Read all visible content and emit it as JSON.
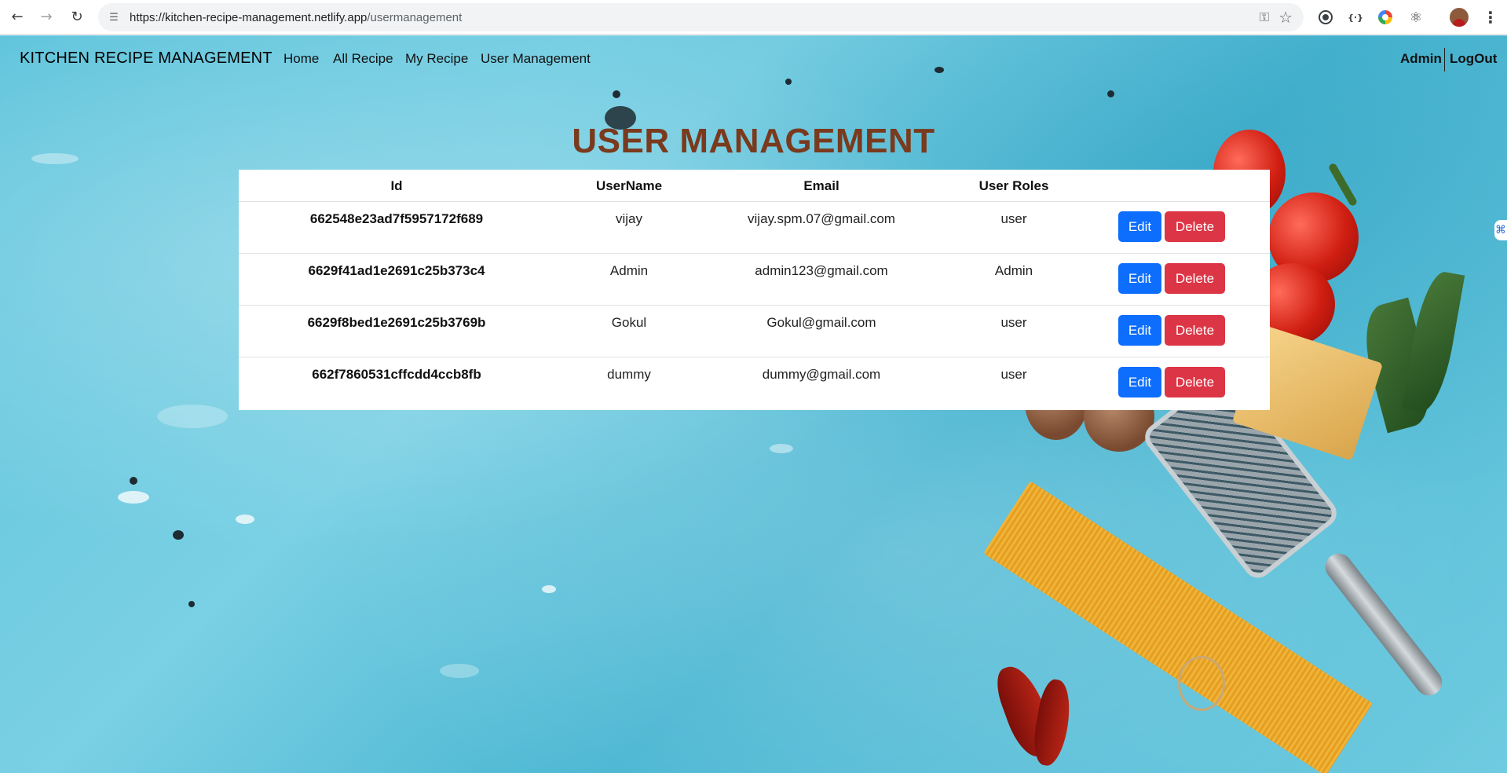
{
  "browser": {
    "url_host": "https://kitchen-recipe-management.netlify.app",
    "url_path": "/usermanagement",
    "icons": [
      "back-icon",
      "forward-icon",
      "reload-icon",
      "site-settings-icon",
      "password-key-icon",
      "bookmark-star-icon",
      "record-extension-icon",
      "code-extension-icon",
      "color-extension-icon",
      "extensions-puzzle-icon",
      "profile-avatar-icon",
      "kebab-menu-icon"
    ]
  },
  "navbar": {
    "brand": "KITCHEN RECIPE MANAGEMENT",
    "links": [
      "Home",
      "All Recipe",
      "My Recipe",
      "User Management"
    ],
    "user": "Admin",
    "logout": "LogOut"
  },
  "page": {
    "heading": "USER MANAGEMENT"
  },
  "table": {
    "headers": [
      "Id",
      "UserName",
      "Email",
      "User Roles",
      ""
    ],
    "rows": [
      {
        "id": "662548e23ad7f5957172f689",
        "username": "vijay",
        "email": "vijay.spm.07@gmail.com",
        "role": "user"
      },
      {
        "id": "6629f41ad1e2691c25b373c4",
        "username": "Admin",
        "email": "admin123@gmail.com",
        "role": "Admin"
      },
      {
        "id": "6629f8bed1e2691c25b3769b",
        "username": "Gokul",
        "email": "Gokul@gmail.com",
        "role": "user"
      },
      {
        "id": "662f7860531cffcdd4ccb8fb",
        "username": "dummy",
        "email": "dummy@gmail.com",
        "role": "user"
      }
    ],
    "edit_label": "Edit",
    "delete_label": "Delete"
  },
  "colors": {
    "heading": "#7a3a1e",
    "edit": "#0d6efd",
    "delete": "#dc3545",
    "background": "#5cc3db"
  }
}
